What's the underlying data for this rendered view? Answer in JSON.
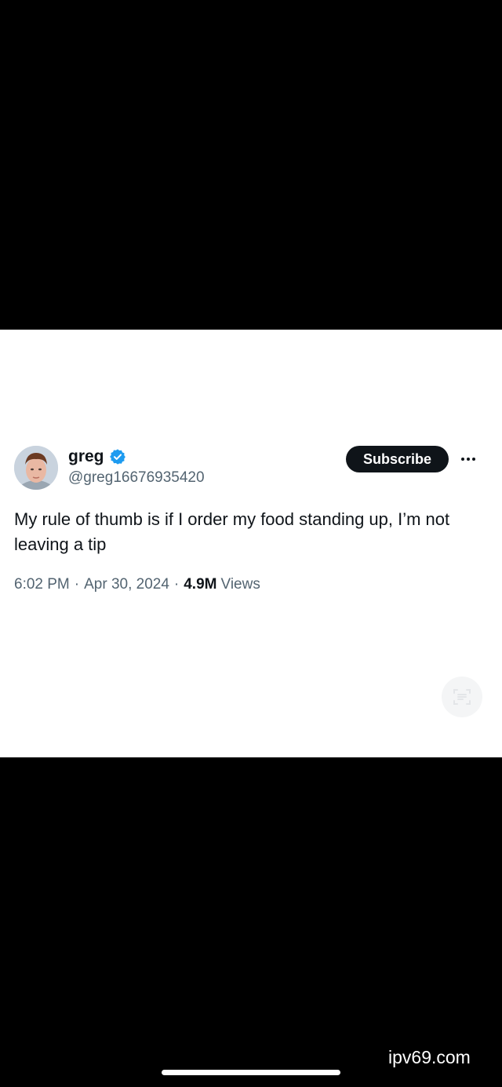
{
  "tweet": {
    "display_name": "greg",
    "handle": "@greg16676935420",
    "subscribe_label": "Subscribe",
    "text": "My rule of thumb is if I order my food standing up, I’m not leaving a tip",
    "time": "6:02 PM",
    "date": "Apr 30, 2024",
    "separator": "·",
    "views_count": "4.9M",
    "views_label": "Views"
  },
  "watermark": "ipv69.com",
  "icons": {
    "verified": "verified-badge-icon",
    "more": "more-options-icon",
    "scan": "scan-text-icon"
  },
  "colors": {
    "verified_blue": "#1d9bf0",
    "text_primary": "#0f1419",
    "text_secondary": "#536471",
    "subscribe_bg": "#0f1419"
  }
}
